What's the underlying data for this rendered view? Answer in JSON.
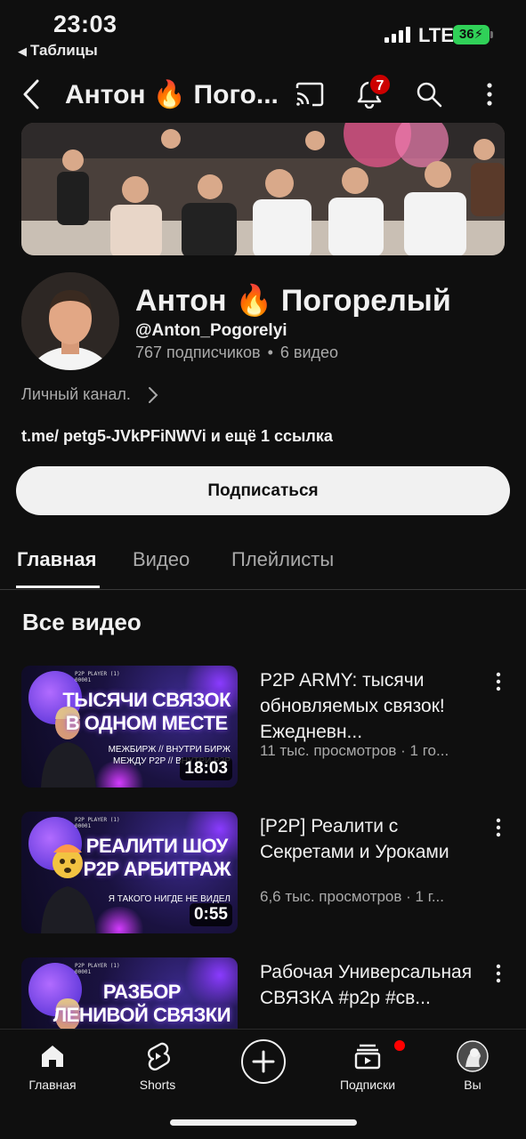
{
  "status_bar": {
    "time": "23:03",
    "back_app": "Таблицы",
    "network": "LTE",
    "battery": "36"
  },
  "app_bar": {
    "title": "Антон 🔥 Пого...",
    "notification_count": "7"
  },
  "channel": {
    "name": "Антон 🔥 Погорелый",
    "handle": "@Anton_Pogorelyi",
    "subscribers": "767 подписчиков",
    "videos_count": "6 видео",
    "description": "Личный канал.",
    "links": "t.me/ petg5-JVkPFiNWVi и ещё 1 ссылка",
    "subscribe_label": "Подписаться"
  },
  "tabs": [
    {
      "label": "Главная",
      "active": true
    },
    {
      "label": "Видео",
      "active": false
    },
    {
      "label": "Плейлисты",
      "active": false
    }
  ],
  "section_title": "Все видео",
  "videos": [
    {
      "title": "P2P ARMY: тысячи обновляемых связок! Ежедневн...",
      "meta": "11 тыс. просмотров · 1 го...",
      "duration": "18:03",
      "thumb_tag": "P2P PLAYER (1)\n00001",
      "thumb_text": "ТЫСЯЧИ СВЯЗОК\nВ ОДНОМ МЕСТЕ",
      "thumb_small": "МЕЖБИРЖ // ВНУТРИ БИРЖ\nМЕЖДУ P2P // ВНУТРИ P2P"
    },
    {
      "title": "[P2P] Реалити с Секретами и Уроками",
      "meta": "6,6 тыс. просмотров · 1 г...",
      "duration": "0:55",
      "thumb_tag": "P2P PLAYER (1)\n00001",
      "thumb_text": "РЕАЛИТИ ШОУ\nP2P АРБИТРАЖ",
      "thumb_small": "Я ТАКОГО НИГДЕ НЕ ВИДЕЛ"
    },
    {
      "title": "Рабочая Универсальная СВЯЗКА #p2p #св...",
      "meta": "",
      "duration": "",
      "thumb_tag": "P2P PLAYER (1)\n00001",
      "thumb_text": "РАЗБОР\nЛЕНИВОЙ СВЯЗКИ",
      "thumb_small": ""
    }
  ],
  "bottom_nav": [
    {
      "label": "Главная",
      "icon": "home-icon"
    },
    {
      "label": "Shorts",
      "icon": "shorts-icon"
    },
    {
      "label": "",
      "icon": "create-icon"
    },
    {
      "label": "Подписки",
      "icon": "subscriptions-icon"
    },
    {
      "label": "Вы",
      "icon": "you-avatar"
    }
  ],
  "colors": {
    "background": "#0f0f0f",
    "text": "#f1f1f1",
    "secondary": "#aaaaaa",
    "badge": "#cc0000",
    "battery": "#30d158"
  }
}
